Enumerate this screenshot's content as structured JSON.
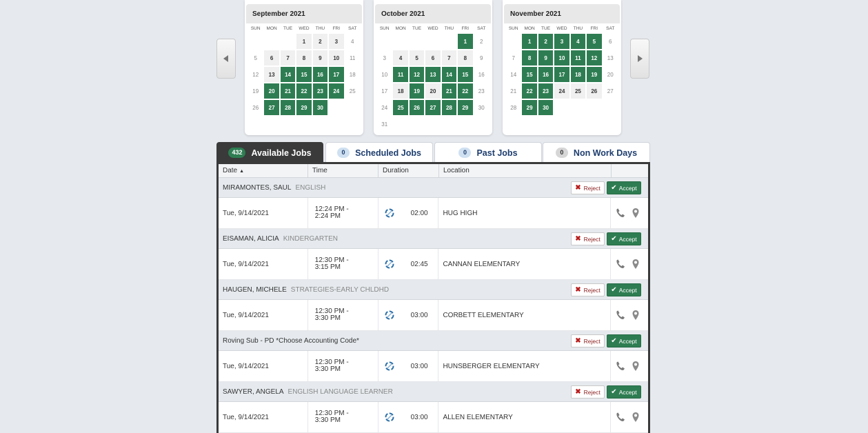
{
  "nav": {
    "prev_icon": "caret-left-icon",
    "next_icon": "caret-right-icon"
  },
  "calendars": [
    {
      "title": "September 2021",
      "dow": [
        "SUN",
        "MON",
        "TUE",
        "WED",
        "THU",
        "FRI",
        "SAT"
      ],
      "weeks": [
        [
          [
            "",
            "e"
          ],
          [
            "",
            "e"
          ],
          [
            "",
            "e"
          ],
          [
            "1",
            "n"
          ],
          [
            "2",
            "n"
          ],
          [
            "3",
            "n"
          ],
          [
            "4",
            "o"
          ]
        ],
        [
          [
            "5",
            "o"
          ],
          [
            "6",
            "n"
          ],
          [
            "7",
            "n"
          ],
          [
            "8",
            "n"
          ],
          [
            "9",
            "n"
          ],
          [
            "10",
            "n"
          ],
          [
            "11",
            "o"
          ]
        ],
        [
          [
            "12",
            "o"
          ],
          [
            "13",
            "n"
          ],
          [
            "14",
            "j"
          ],
          [
            "15",
            "j"
          ],
          [
            "16",
            "j"
          ],
          [
            "17",
            "j"
          ],
          [
            "18",
            "o"
          ]
        ],
        [
          [
            "19",
            "o"
          ],
          [
            "20",
            "j"
          ],
          [
            "21",
            "j"
          ],
          [
            "22",
            "j"
          ],
          [
            "23",
            "j"
          ],
          [
            "24",
            "j"
          ],
          [
            "25",
            "o"
          ]
        ],
        [
          [
            "26",
            "o"
          ],
          [
            "27",
            "j"
          ],
          [
            "28",
            "j"
          ],
          [
            "29",
            "j"
          ],
          [
            "30",
            "j"
          ],
          [
            "",
            "e"
          ],
          [
            "",
            "e"
          ]
        ]
      ]
    },
    {
      "title": "October 2021",
      "dow": [
        "SUN",
        "MON",
        "TUE",
        "WED",
        "THU",
        "FRI",
        "SAT"
      ],
      "weeks": [
        [
          [
            "",
            "e"
          ],
          [
            "",
            "e"
          ],
          [
            "",
            "e"
          ],
          [
            "",
            "e"
          ],
          [
            "",
            "e"
          ],
          [
            "1",
            "j"
          ],
          [
            "2",
            "o"
          ]
        ],
        [
          [
            "3",
            "o"
          ],
          [
            "4",
            "n"
          ],
          [
            "5",
            "n"
          ],
          [
            "6",
            "n"
          ],
          [
            "7",
            "n"
          ],
          [
            "8",
            "n"
          ],
          [
            "9",
            "o"
          ]
        ],
        [
          [
            "10",
            "o"
          ],
          [
            "11",
            "j"
          ],
          [
            "12",
            "j"
          ],
          [
            "13",
            "j"
          ],
          [
            "14",
            "j"
          ],
          [
            "15",
            "j"
          ],
          [
            "16",
            "o"
          ]
        ],
        [
          [
            "17",
            "o"
          ],
          [
            "18",
            "n"
          ],
          [
            "19",
            "j"
          ],
          [
            "20",
            "n"
          ],
          [
            "21",
            "j"
          ],
          [
            "22",
            "j"
          ],
          [
            "23",
            "o"
          ]
        ],
        [
          [
            "24",
            "o"
          ],
          [
            "25",
            "j"
          ],
          [
            "26",
            "j"
          ],
          [
            "27",
            "j"
          ],
          [
            "28",
            "j"
          ],
          [
            "29",
            "j"
          ],
          [
            "30",
            "o"
          ]
        ],
        [
          [
            "31",
            "o"
          ],
          [
            "",
            "e"
          ],
          [
            "",
            "e"
          ],
          [
            "",
            "e"
          ],
          [
            "",
            "e"
          ],
          [
            "",
            "e"
          ],
          [
            "",
            "e"
          ]
        ]
      ]
    },
    {
      "title": "November 2021",
      "dow": [
        "SUN",
        "MON",
        "TUE",
        "WED",
        "THU",
        "FRI",
        "SAT"
      ],
      "weeks": [
        [
          [
            "",
            "e"
          ],
          [
            "1",
            "j"
          ],
          [
            "2",
            "j"
          ],
          [
            "3",
            "j"
          ],
          [
            "4",
            "j"
          ],
          [
            "5",
            "j"
          ],
          [
            "6",
            "o"
          ]
        ],
        [
          [
            "7",
            "o"
          ],
          [
            "8",
            "j"
          ],
          [
            "9",
            "j"
          ],
          [
            "10",
            "j"
          ],
          [
            "11",
            "j"
          ],
          [
            "12",
            "j"
          ],
          [
            "13",
            "o"
          ]
        ],
        [
          [
            "14",
            "o"
          ],
          [
            "15",
            "j"
          ],
          [
            "16",
            "j"
          ],
          [
            "17",
            "j"
          ],
          [
            "18",
            "j"
          ],
          [
            "19",
            "j"
          ],
          [
            "20",
            "o"
          ]
        ],
        [
          [
            "21",
            "o"
          ],
          [
            "22",
            "j"
          ],
          [
            "23",
            "j"
          ],
          [
            "24",
            "n"
          ],
          [
            "25",
            "n"
          ],
          [
            "26",
            "n"
          ],
          [
            "27",
            "o"
          ]
        ],
        [
          [
            "28",
            "o"
          ],
          [
            "29",
            "j"
          ],
          [
            "30",
            "j"
          ],
          [
            "",
            "e"
          ],
          [
            "",
            "e"
          ],
          [
            "",
            "e"
          ],
          [
            "",
            "e"
          ]
        ]
      ]
    }
  ],
  "tabs": [
    {
      "label": "Available Jobs",
      "count": "432"
    },
    {
      "label": "Scheduled Jobs",
      "count": "0"
    },
    {
      "label": "Past Jobs",
      "count": "0"
    },
    {
      "label": "Non Work Days",
      "count": "0"
    }
  ],
  "columns": {
    "date": "Date",
    "time": "Time",
    "duration": "Duration",
    "location": "Location"
  },
  "buttons": {
    "reject": "Reject",
    "accept": "Accept"
  },
  "jobs": [
    {
      "name": "MIRAMONTES, SAUL",
      "subject": "ENGLISH",
      "date": "Tue, 9/14/2021",
      "time_start": "12:24 PM -",
      "time_end": "2:24 PM",
      "duration": "02:00",
      "location": "HUG HIGH"
    },
    {
      "name": "EISAMAN, ALICIA",
      "subject": "KINDERGARTEN",
      "date": "Tue, 9/14/2021",
      "time_start": "12:30 PM -",
      "time_end": "3:15 PM",
      "duration": "02:45",
      "location": "CANNAN ELEMENTARY"
    },
    {
      "name": "HAUGEN, MICHELE",
      "subject": "STRATEGIES-EARLY CHLDHD",
      "date": "Tue, 9/14/2021",
      "time_start": "12:30 PM -",
      "time_end": "3:30 PM",
      "duration": "03:00",
      "location": "CORBETT ELEMENTARY"
    },
    {
      "name": "Roving Sub - PD *Choose Accounting Code*",
      "subject": "",
      "date": "Tue, 9/14/2021",
      "time_start": "12:30 PM -",
      "time_end": "3:30 PM",
      "duration": "03:00",
      "location": "HUNSBERGER ELEMENTARY"
    },
    {
      "name": "SAWYER, ANGELA",
      "subject": "ENGLISH LANGUAGE LEARNER",
      "date": "Tue, 9/14/2021",
      "time_start": "12:30 PM -",
      "time_end": "3:30 PM",
      "duration": "03:00",
      "location": "ALLEN ELEMENTARY"
    }
  ],
  "colors": {
    "job_day": "#2e7d52",
    "active_tab": "#3a3a3a",
    "tab_text": "#1d3d6e",
    "reject": "#b71c1c"
  }
}
